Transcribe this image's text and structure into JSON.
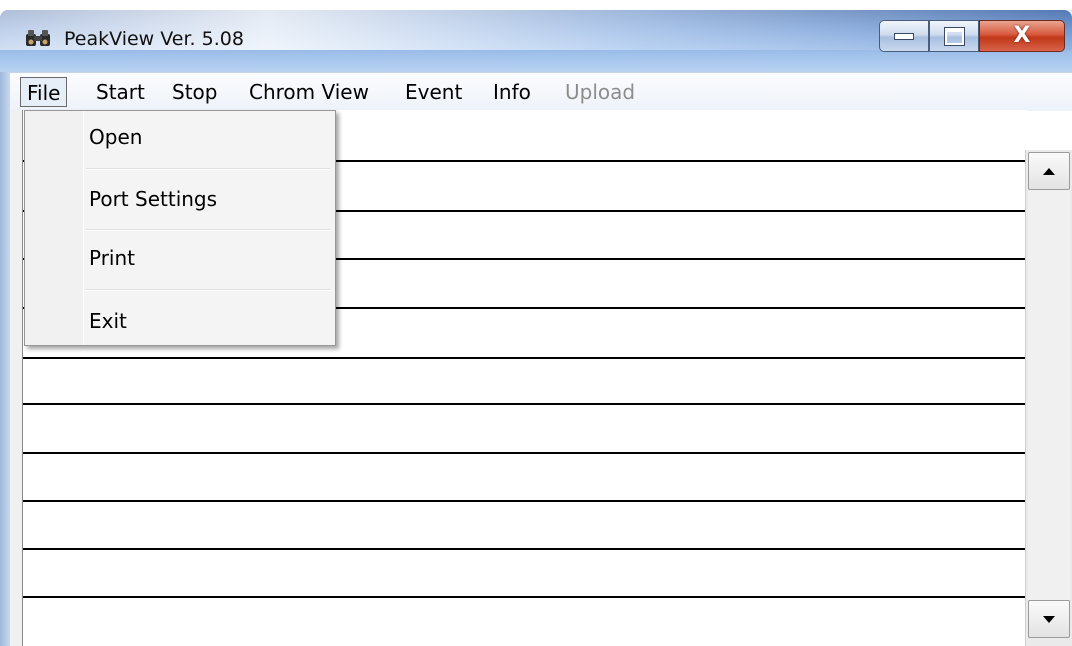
{
  "window": {
    "title": "PeakView  Ver. 5.08",
    "icon": "binoculars-icon",
    "controls": {
      "minimize": "minimize-icon",
      "maximize": "maximize-icon",
      "close_label": "X"
    }
  },
  "menubar": {
    "items": [
      {
        "label": "File",
        "state": "open"
      },
      {
        "label": "Start",
        "state": "enabled"
      },
      {
        "label": "Stop",
        "state": "enabled"
      },
      {
        "label": "Chrom View",
        "state": "enabled"
      },
      {
        "label": "Event",
        "state": "enabled"
      },
      {
        "label": "Info",
        "state": "enabled"
      },
      {
        "label": "Upload",
        "state": "disabled"
      }
    ]
  },
  "file_menu": {
    "items": [
      {
        "label": "Open"
      },
      {
        "label": "Port Settings"
      },
      {
        "label": "Print"
      },
      {
        "label": "Exit"
      }
    ]
  },
  "scrollbar": {
    "up_icon": "arrow-up-icon",
    "down_icon": "arrow-down-icon"
  },
  "colors": {
    "menu_disabled_text": "#8d8d8d",
    "close_button": "#c03818",
    "titlebar_blue": "#6f95cf"
  }
}
